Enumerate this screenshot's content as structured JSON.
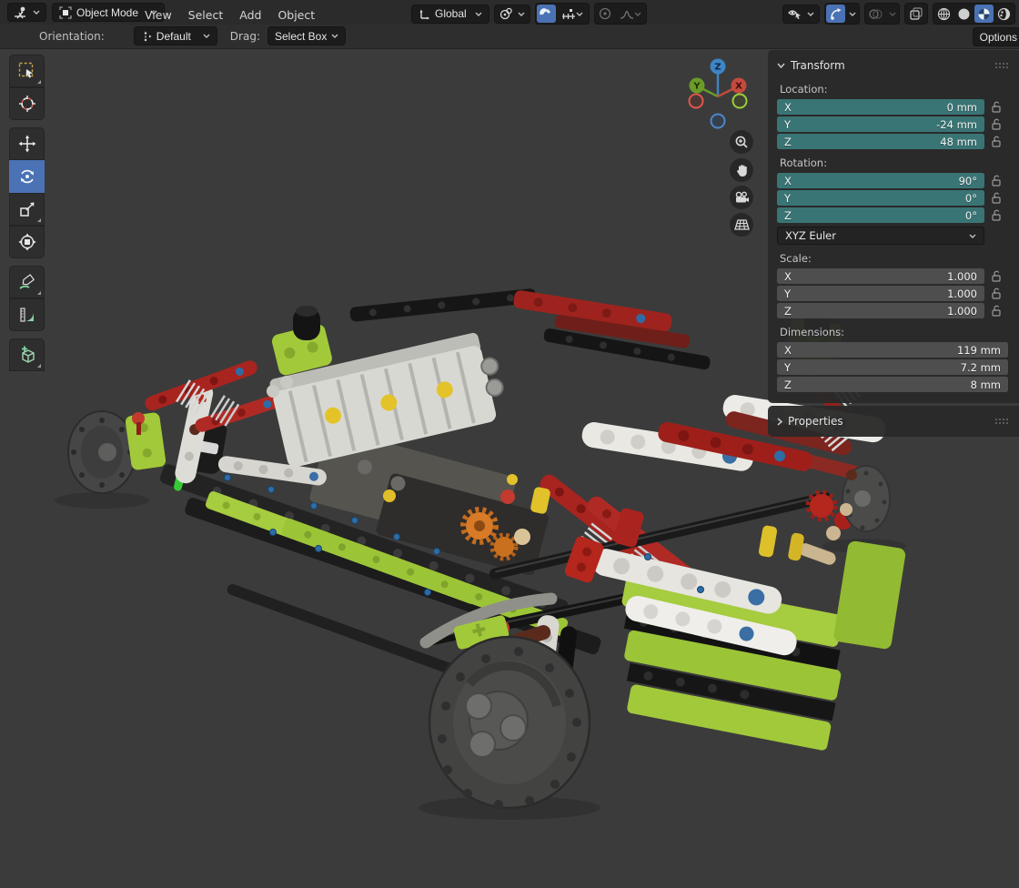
{
  "header": {
    "editor_icon": "3d-viewport-editor-icon",
    "mode": {
      "label": "Object Mode",
      "icon": "object-mode-icon"
    },
    "menus": [
      {
        "label": "View"
      },
      {
        "label": "Select"
      },
      {
        "label": "Add"
      },
      {
        "label": "Object"
      }
    ],
    "transform_orientation": {
      "label": "Global",
      "icon": "orientation-global-icon"
    },
    "pivot_icon": "pivot-point-icon",
    "snap": {
      "enabled": true,
      "magnet_icon": "snap-magnet-icon",
      "target_icon": "snap-increment-icon"
    },
    "proportional": {
      "enabled": false,
      "icons": [
        "proportional-edit-icon",
        "falloff-curve-icon"
      ]
    },
    "view_toggles": {
      "visibility_icon": "object-type-visibility-icon",
      "gizmos": {
        "enabled": true,
        "icon": "gizmo-icon"
      },
      "overlays": {
        "enabled": false,
        "icon": "overlays-icon"
      },
      "xray": {
        "enabled": false,
        "icon": "xray-icon"
      },
      "shading": {
        "modes": [
          "Wireframe",
          "Solid",
          "Material Preview",
          "Rendered"
        ],
        "active": "Material Preview"
      }
    }
  },
  "tool_settings": {
    "orientation_label": "Orientation:",
    "orientation_value": "Default",
    "drag_label": "Drag:",
    "drag_value": "Select Box",
    "options_label": "Options"
  },
  "toolbar": {
    "active_tool": "Rotate",
    "tools": [
      "Select Box",
      "Cursor",
      "Move",
      "Rotate",
      "Scale",
      "Transform",
      "Annotate",
      "Measure",
      "Add Cube"
    ]
  },
  "sidebar": {
    "transform": {
      "title": "Transform",
      "location": {
        "label": "Location:",
        "x": {
          "axis": "X",
          "value": "0 mm"
        },
        "y": {
          "axis": "Y",
          "value": "-24 mm"
        },
        "z": {
          "axis": "Z",
          "value": "48 mm"
        }
      },
      "rotation": {
        "label": "Rotation:",
        "x": {
          "axis": "X",
          "value": "90°"
        },
        "y": {
          "axis": "Y",
          "value": "0°"
        },
        "z": {
          "axis": "Z",
          "value": "0°"
        },
        "mode": "XYZ Euler"
      },
      "scale": {
        "label": "Scale:",
        "x": {
          "axis": "X",
          "value": "1.000"
        },
        "y": {
          "axis": "Y",
          "value": "1.000"
        },
        "z": {
          "axis": "Z",
          "value": "1.000"
        }
      },
      "dimensions": {
        "label": "Dimensions:",
        "x": {
          "axis": "X",
          "value": "119 mm"
        },
        "y": {
          "axis": "Y",
          "value": "7.2 mm"
        },
        "z": {
          "axis": "Z",
          "value": "8 mm"
        }
      }
    },
    "properties": {
      "title": "Properties"
    }
  },
  "nav_gizmo": {
    "x": "X",
    "y": "Y",
    "z": "Z"
  },
  "viewport_widgets": [
    "zoom-icon",
    "pan-hand-icon",
    "camera-view-icon",
    "toggle-ortho-grid-icon"
  ],
  "scene": {
    "model": "LEGO Technic supercar chassis"
  },
  "colors": {
    "accent_blue": "#4a72b4",
    "field_teal": "#3a7575",
    "field_gray": "#4e4e4e",
    "axis_x": "#c44a3e",
    "axis_y": "#6b9b28",
    "axis_z": "#3d85c6",
    "lego_lime": "#a2c93a",
    "lego_red": "#a8241f",
    "viewport_bg": "#3b3b3b"
  }
}
